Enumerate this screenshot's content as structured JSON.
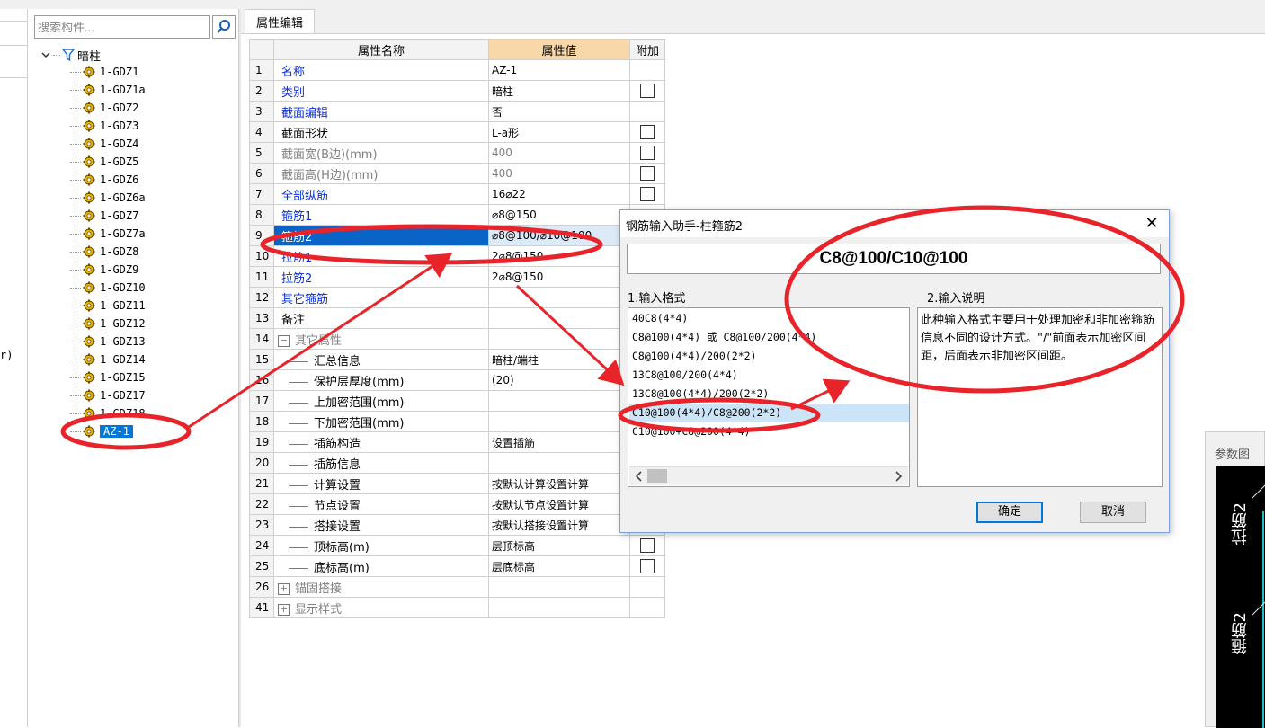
{
  "left_edge_text": "r)",
  "tree": {
    "search_placeholder": "搜索构件...",
    "root_label": "暗柱",
    "items": [
      "1-GDZ1",
      "1-GDZ1a",
      "1-GDZ2",
      "1-GDZ3",
      "1-GDZ4",
      "1-GDZ5",
      "1-GDZ6",
      "1-GDZ6a",
      "1-GDZ7",
      "1-GDZ7a",
      "1-GDZ8",
      "1-GDZ9",
      "1-GDZ10",
      "1-GDZ11",
      "1-GDZ12",
      "1-GDZ13",
      "1-GDZ14",
      "1-GDZ15",
      "1-GDZ17",
      "1-GDZ18",
      "AZ-1"
    ],
    "selected_item": "AZ-1"
  },
  "props": {
    "tab_label": "属性编辑",
    "headers": {
      "name": "属性名称",
      "value": "属性值",
      "extra": "附加"
    },
    "rows": [
      {
        "num": "1",
        "name": "名称",
        "value": "AZ-1",
        "style": "blue",
        "checkbox": false
      },
      {
        "num": "2",
        "name": "类别",
        "value": "暗柱",
        "style": "blue",
        "checkbox": true
      },
      {
        "num": "3",
        "name": "截面编辑",
        "value": "否",
        "style": "blue",
        "checkbox": false
      },
      {
        "num": "4",
        "name": "截面形状",
        "value": "L-a形",
        "style": "normal",
        "checkbox": true
      },
      {
        "num": "5",
        "name": "截面宽(B边)(mm)",
        "value": "400",
        "style": "gray",
        "checkbox": true
      },
      {
        "num": "6",
        "name": "截面高(H边)(mm)",
        "value": "400",
        "style": "gray",
        "checkbox": true
      },
      {
        "num": "7",
        "name": "全部纵筋",
        "value": "16⌀22",
        "style": "blue",
        "checkbox": true
      },
      {
        "num": "8",
        "name": "箍筋1",
        "value": "⌀8@150",
        "style": "blue",
        "checkbox": false
      },
      {
        "num": "9",
        "name": "箍筋2",
        "value": "⌀8@100/⌀10@100",
        "style": "blue",
        "checkbox": false,
        "selected": true
      },
      {
        "num": "10",
        "name": "拉筋1",
        "value": "2⌀8@150",
        "style": "blue",
        "checkbox": false
      },
      {
        "num": "11",
        "name": "拉筋2",
        "value": "2⌀8@150",
        "style": "blue",
        "checkbox": false
      },
      {
        "num": "12",
        "name": "其它箍筋",
        "value": "",
        "style": "blue",
        "checkbox": false
      },
      {
        "num": "13",
        "name": "备注",
        "value": "",
        "style": "normal",
        "checkbox": false
      },
      {
        "num": "14",
        "name": "其它属性",
        "value": "",
        "style": "gray",
        "group": "minus",
        "checkbox": false
      },
      {
        "num": "15",
        "name": "汇总信息",
        "value": "暗柱/端柱",
        "style": "child",
        "checkbox": false
      },
      {
        "num": "16",
        "name": "保护层厚度(mm)",
        "value": "(20)",
        "style": "child",
        "checkbox": false
      },
      {
        "num": "17",
        "name": "上加密范围(mm)",
        "value": "",
        "style": "child",
        "checkbox": false
      },
      {
        "num": "18",
        "name": "下加密范围(mm)",
        "value": "",
        "style": "child",
        "checkbox": false
      },
      {
        "num": "19",
        "name": "插筋构造",
        "value": "设置插筋",
        "style": "child",
        "checkbox": false
      },
      {
        "num": "20",
        "name": "插筋信息",
        "value": "",
        "style": "child",
        "checkbox": false
      },
      {
        "num": "21",
        "name": "计算设置",
        "value": "按默认计算设置计算",
        "style": "child",
        "checkbox": false
      },
      {
        "num": "22",
        "name": "节点设置",
        "value": "按默认节点设置计算",
        "style": "child",
        "checkbox": false
      },
      {
        "num": "23",
        "name": "搭接设置",
        "value": "按默认搭接设置计算",
        "style": "child",
        "checkbox": false
      },
      {
        "num": "24",
        "name": "顶标高(m)",
        "value": "层顶标高",
        "style": "child",
        "checkbox": true
      },
      {
        "num": "25",
        "name": "底标高(m)",
        "value": "层底标高",
        "style": "childlast",
        "checkbox": true
      },
      {
        "num": "26",
        "name": "锚固搭接",
        "value": "",
        "style": "gray",
        "group": "plus",
        "checkbox": false
      },
      {
        "num": "41",
        "name": "显示样式",
        "value": "",
        "style": "gray",
        "group": "plus",
        "checkbox": false
      }
    ]
  },
  "dialog": {
    "title": "钢筋输入助手-柱箍筋2",
    "close": "✕",
    "formula": "C8@100/C10@100",
    "format_label": "1.输入格式",
    "desc_label": "2.输入说明",
    "formats": [
      "40C8(4*4)",
      "C8@100(4*4) 或 C8@100/200(4*4)",
      "C8@100(4*4)/200(2*2)",
      "13C8@100/200(4*4)",
      "13C8@100(4*4)/200(2*2)",
      "C10@100(4*4)/C8@200(2*2)",
      "C10@100+C8@200(4*4)"
    ],
    "selected_format": "C10@100(4*4)/C8@200(2*2)",
    "description": "此种输入格式主要用于处理加密和非加密箍筋信息不同的设计方式。\"/\"前面表示加密区间距，后面表示非加密区间距。",
    "ok": "确定",
    "cancel": "取消"
  },
  "param": {
    "title": "参数图",
    "label_top": "拉筋2",
    "label_bottom": "箍筋2"
  },
  "colors": {
    "selection_blue": "#0a64c8",
    "header_orange": "#f8d7a8",
    "link_blue": "#0b2fd6",
    "annotation_red": "#e8232a"
  }
}
